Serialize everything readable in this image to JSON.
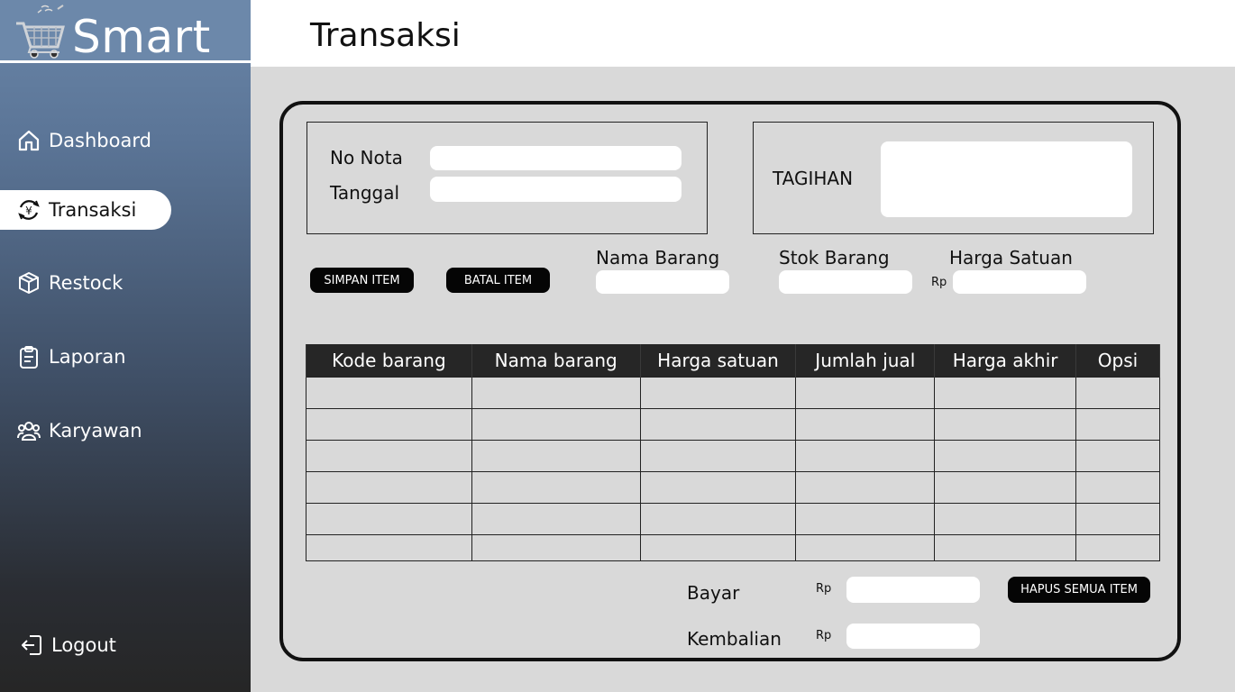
{
  "brand": {
    "name": "Smart",
    "icon": "shopping-cart-icon"
  },
  "header": {
    "title": "Transaksi"
  },
  "sidebar": {
    "items": [
      {
        "label": "Dashboard",
        "icon": "home-icon",
        "active": false
      },
      {
        "label": "Transaksi",
        "icon": "currency-exchange-icon",
        "active": true
      },
      {
        "label": "Restock",
        "icon": "box-icon",
        "active": false
      },
      {
        "label": "Laporan",
        "icon": "clipboard-icon",
        "active": false
      },
      {
        "label": "Karyawan",
        "icon": "users-icon",
        "active": false
      }
    ],
    "logout": {
      "label": "Logout",
      "icon": "logout-icon"
    }
  },
  "invoice": {
    "no_nota_label": "No Nota",
    "no_nota_value": "",
    "tanggal_label": "Tanggal",
    "tanggal_value": ""
  },
  "tagihan": {
    "label": "TAGIHAN",
    "value": ""
  },
  "item_form": {
    "simpan_label": "SIMPAN ITEM",
    "batal_label": "BATAL ITEM",
    "nama_barang_label": "Nama Barang",
    "stok_barang_label": "Stok Barang",
    "harga_satuan_label": "Harga Satuan",
    "currency": "Rp",
    "nama_barang_value": "",
    "stok_barang_value": "",
    "harga_satuan_value": ""
  },
  "table": {
    "columns": [
      "Kode barang",
      "Nama barang",
      "Harga satuan",
      "Jumlah jual",
      "Harga akhir",
      "Opsi"
    ],
    "rows": [
      [
        "",
        "",
        "",
        "",
        "",
        ""
      ],
      [
        "",
        "",
        "",
        "",
        "",
        ""
      ],
      [
        "",
        "",
        "",
        "",
        "",
        ""
      ],
      [
        "",
        "",
        "",
        "",
        "",
        ""
      ],
      [
        "",
        "",
        "",
        "",
        "",
        ""
      ],
      [
        "",
        "",
        "",
        "",
        "",
        ""
      ]
    ]
  },
  "payment": {
    "bayar_label": "Bayar",
    "kembalian_label": "Kembalian",
    "currency": "Rp",
    "bayar_value": "",
    "kembalian_value": "",
    "hapus_label": "HAPUS SEMUA ITEM"
  }
}
